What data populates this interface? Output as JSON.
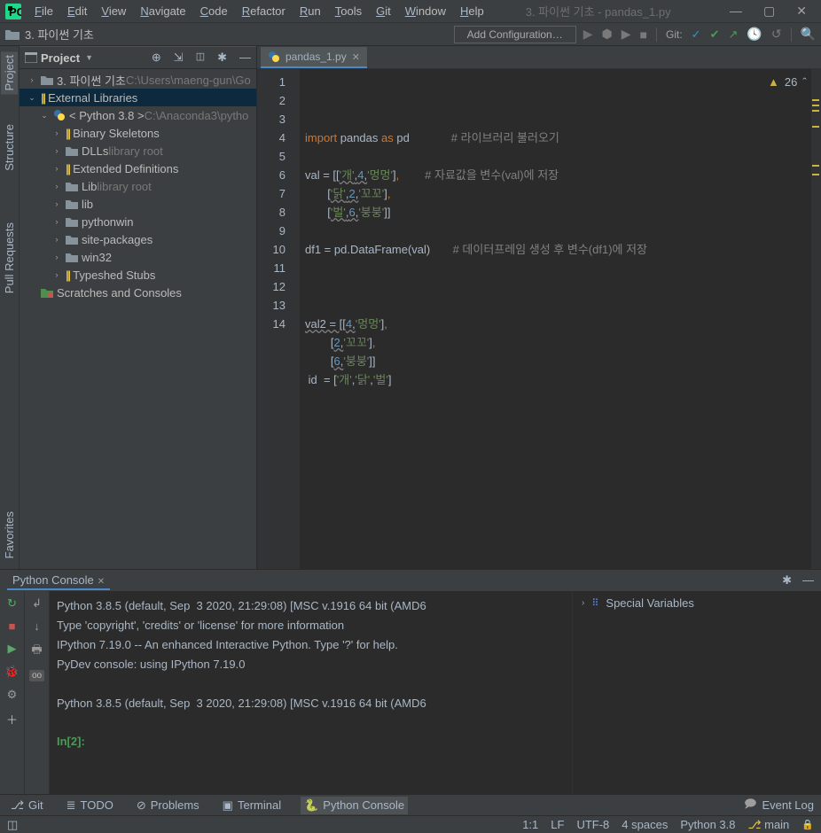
{
  "title": "3. 파이썬 기초 - pandas_1.py",
  "menu": [
    "File",
    "Edit",
    "View",
    "Navigate",
    "Code",
    "Refactor",
    "Run",
    "Tools",
    "Git",
    "Window",
    "Help"
  ],
  "breadcrumb": "3. 파이썬 기초",
  "add_conf": "Add Configuration…",
  "git_label": "Git:",
  "left_tabs": [
    "Project",
    "Structure",
    "Pull Requests",
    "Favorites"
  ],
  "project_panel": {
    "title": "Project",
    "nodes": [
      {
        "ind": 0,
        "tw": "›",
        "icon": "dir",
        "text": "3. 파이썬 기초",
        "suffix": "C:\\Users\\maeng-gun\\Go"
      },
      {
        "ind": 0,
        "tw": "⌄",
        "icon": "lib",
        "text": "External Libraries",
        "sel": true
      },
      {
        "ind": 1,
        "tw": "⌄",
        "icon": "py",
        "text": "< Python 3.8 >",
        "suffix": "C:\\Anaconda3\\pytho"
      },
      {
        "ind": 2,
        "tw": "›",
        "icon": "lib",
        "text": "Binary Skeletons"
      },
      {
        "ind": 2,
        "tw": "›",
        "icon": "dir",
        "text": "DLLs",
        "suffix": "library root"
      },
      {
        "ind": 2,
        "tw": "›",
        "icon": "lib",
        "text": "Extended Definitions"
      },
      {
        "ind": 2,
        "tw": "›",
        "icon": "dir",
        "text": "Lib",
        "suffix": "library root"
      },
      {
        "ind": 2,
        "tw": "›",
        "icon": "dir",
        "text": "lib"
      },
      {
        "ind": 2,
        "tw": "›",
        "icon": "dir",
        "text": "pythonwin"
      },
      {
        "ind": 2,
        "tw": "›",
        "icon": "dir",
        "text": "site-packages"
      },
      {
        "ind": 2,
        "tw": "›",
        "icon": "dir",
        "text": "win32"
      },
      {
        "ind": 2,
        "tw": "›",
        "icon": "lib",
        "text": "Typeshed Stubs"
      },
      {
        "ind": 0,
        "tw": "",
        "icon": "scratch",
        "text": "Scratches and Consoles"
      }
    ]
  },
  "editor_tab": "pandas_1.py",
  "line_nums": [
    "1",
    "2",
    "3",
    "4",
    "5",
    "6",
    "7",
    "8",
    "9",
    "10",
    "11",
    "12",
    "13",
    "14"
  ],
  "warn_count": "26",
  "code_lines": [
    [
      {
        "t": "import ",
        "c": "kw"
      },
      {
        "t": "pandas ",
        "c": "fn"
      },
      {
        "t": "as ",
        "c": "kw"
      },
      {
        "t": "pd",
        "c": "fn"
      },
      {
        "t": "             ",
        "c": "fn"
      },
      {
        "t": "# 라이브러리 불러오기",
        "c": "cm"
      }
    ],
    [],
    [
      {
        "t": "val = [[",
        "c": "fn"
      },
      {
        "t": "'개'",
        "c": "st",
        "w": 1
      },
      {
        "t": ",",
        "c": "fn",
        "w": 1
      },
      {
        "t": "4",
        "c": "nm",
        "w": 1
      },
      {
        "t": ",",
        "c": "fn",
        "w": 1
      },
      {
        "t": "'멍멍'",
        "c": "st"
      },
      {
        "t": "]",
        "c": "fn"
      },
      {
        "t": ",",
        "c": "kw"
      },
      {
        "t": "        ",
        "c": "fn"
      },
      {
        "t": "# 자료값을 변수(val)에 저장",
        "c": "cm"
      }
    ],
    [
      {
        "t": "       [",
        "c": "fn"
      },
      {
        "t": "'닭'",
        "c": "st",
        "w": 1
      },
      {
        "t": ",",
        "c": "fn",
        "w": 1
      },
      {
        "t": "2",
        "c": "nm",
        "w": 1
      },
      {
        "t": ",",
        "c": "fn",
        "w": 1
      },
      {
        "t": "'꼬꼬'",
        "c": "st"
      },
      {
        "t": "]",
        "c": "fn"
      },
      {
        "t": ",",
        "c": "kw"
      }
    ],
    [
      {
        "t": "       [",
        "c": "fn"
      },
      {
        "t": "'벌'",
        "c": "st",
        "w": 1
      },
      {
        "t": ",",
        "c": "fn",
        "w": 1
      },
      {
        "t": "6",
        "c": "nm",
        "w": 1
      },
      {
        "t": ",",
        "c": "fn",
        "w": 1
      },
      {
        "t": "'붕붕'",
        "c": "st"
      },
      {
        "t": "]]",
        "c": "fn"
      }
    ],
    [],
    [
      {
        "t": "df1 = pd.DataFrame(val)",
        "c": "fn"
      },
      {
        "t": "       ",
        "c": "fn"
      },
      {
        "t": "# 데이터프레임 생성 후 변수(df1)에 저장",
        "c": "cm"
      }
    ],
    [],
    [],
    [],
    [
      {
        "t": "val2 = [[",
        "c": "fn",
        "w": 1
      },
      {
        "t": "4",
        "c": "nm",
        "w": 1
      },
      {
        "t": ",",
        "c": "fn",
        "w": 1
      },
      {
        "t": "'멍멍'",
        "c": "st"
      },
      {
        "t": "]",
        "c": "fn"
      },
      {
        "t": ",",
        "c": "kw"
      }
    ],
    [
      {
        "t": "        [",
        "c": "fn"
      },
      {
        "t": "2",
        "c": "nm",
        "w": 1
      },
      {
        "t": ",",
        "c": "fn",
        "w": 1
      },
      {
        "t": "'꼬꼬'",
        "c": "st"
      },
      {
        "t": "]",
        "c": "fn"
      },
      {
        "t": ",",
        "c": "kw"
      }
    ],
    [
      {
        "t": "        [",
        "c": "fn"
      },
      {
        "t": "6",
        "c": "nm",
        "w": 1
      },
      {
        "t": ",",
        "c": "fn",
        "w": 1
      },
      {
        "t": "'붕붕'",
        "c": "st"
      },
      {
        "t": "]]",
        "c": "fn"
      }
    ],
    [
      {
        "t": " id  = [",
        "c": "fn"
      },
      {
        "t": "'개'",
        "c": "st"
      },
      {
        "t": ",",
        "c": "fn"
      },
      {
        "t": "'닭'",
        "c": "st"
      },
      {
        "t": ",",
        "c": "fn"
      },
      {
        "t": "'벌'",
        "c": "st"
      },
      {
        "t": "]",
        "c": "fn"
      }
    ]
  ],
  "console_tab": "Python Console",
  "console_out": "Python 3.8.5 (default, Sep  3 2020, 21:29:08) [MSC v.1916 64 bit (AMD6\nType 'copyright', 'credits' or 'license' for more information\nIPython 7.19.0 -- An enhanced Interactive Python. Type '?' for help.\nPyDev console: using IPython 7.19.0\n\nPython 3.8.5 (default, Sep  3 2020, 21:29:08) [MSC v.1916 64 bit (AMD6",
  "console_prompt": "In[2]:",
  "vars_label": "Special Variables",
  "tool_windows": [
    {
      "icon": "git",
      "label": "Git"
    },
    {
      "icon": "todo",
      "label": "TODO"
    },
    {
      "icon": "prob",
      "label": "Problems"
    },
    {
      "icon": "term",
      "label": "Terminal"
    },
    {
      "icon": "py",
      "label": "Python Console",
      "sel": true
    }
  ],
  "event_log": "Event Log",
  "status": {
    "pos": "1:1",
    "le": "LF",
    "enc": "UTF-8",
    "indent": "4 spaces",
    "interp": "Python 3.8",
    "branch": "main"
  }
}
